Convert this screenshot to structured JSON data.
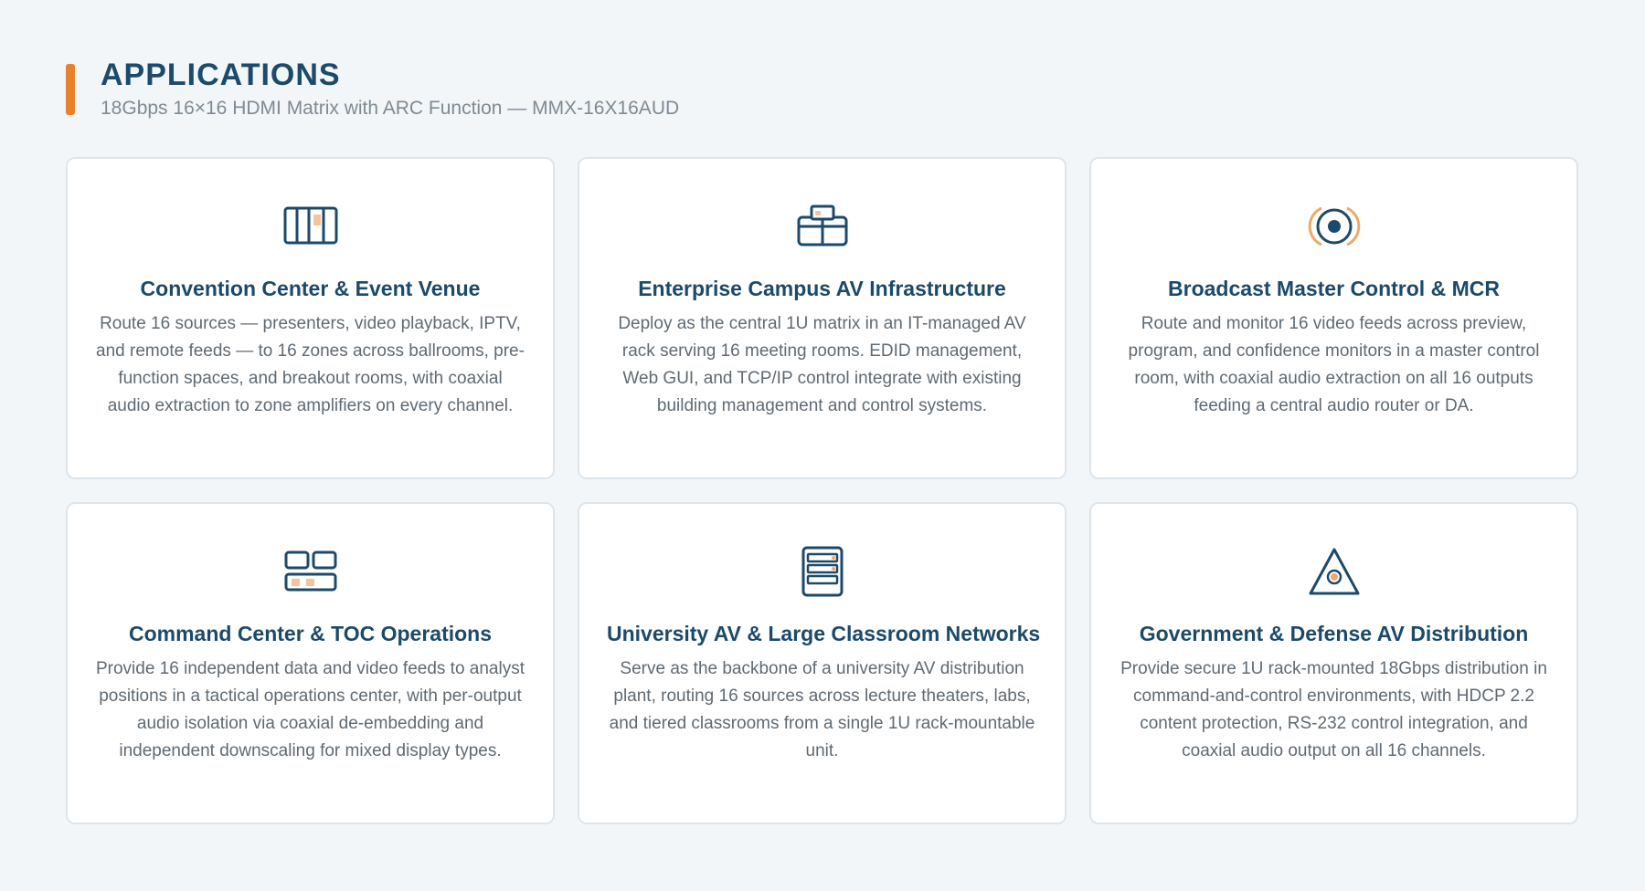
{
  "header": {
    "title": "APPLICATIONS",
    "subtitle": "18Gbps 16×16 HDMI Matrix with ARC Function — MMX-16X16AUD"
  },
  "colors": {
    "accent": "#e8812a",
    "title": "#1b4a6b",
    "body_text": "#5f6a73",
    "background": "#f2f6f9"
  },
  "cards": [
    {
      "icon": "matrix-panel-icon",
      "title": "Convention Center & Event Venue",
      "description": "Route 16 sources — presenters, video playback, IPTV, and remote feeds — to 16 zones across ballrooms, pre-function spaces, and breakout rooms, with coaxial audio extraction to zone amplifiers on every channel."
    },
    {
      "icon": "network-building-icon",
      "title": "Enterprise Campus AV Infrastructure",
      "description": "Deploy as the central 1U matrix in an IT-managed AV rack serving 16 meeting rooms. EDID management, Web GUI, and TCP/IP control integrate with existing building management and control systems."
    },
    {
      "icon": "broadcast-target-icon",
      "title": "Broadcast Master Control & MCR",
      "description": "Route and monitor 16 video feeds across preview, program, and confidence monitors in a master control room, with coaxial audio extraction on all 16 outputs feeding a central audio router or DA."
    },
    {
      "icon": "command-console-icon",
      "title": "Command Center & TOC Operations",
      "description": "Provide 16 independent data and video feeds to analyst positions in a tactical operations center, with per-output audio isolation via coaxial de-embedding and independent downscaling for mixed display types."
    },
    {
      "icon": "server-rack-icon",
      "title": "University AV & Large Classroom Networks",
      "description": "Serve as the backbone of a university AV distribution plant, routing 16 sources across lecture theaters, labs, and tiered classrooms from a single 1U rack-mountable unit."
    },
    {
      "icon": "secure-triangle-icon",
      "title": "Government & Defense AV Distribution",
      "description": "Provide secure 1U rack-mounted 18Gbps distribution in command-and-control environments, with HDCP 2.2 content protection, RS-232 control integration, and coaxial audio output on all 16 channels."
    }
  ]
}
